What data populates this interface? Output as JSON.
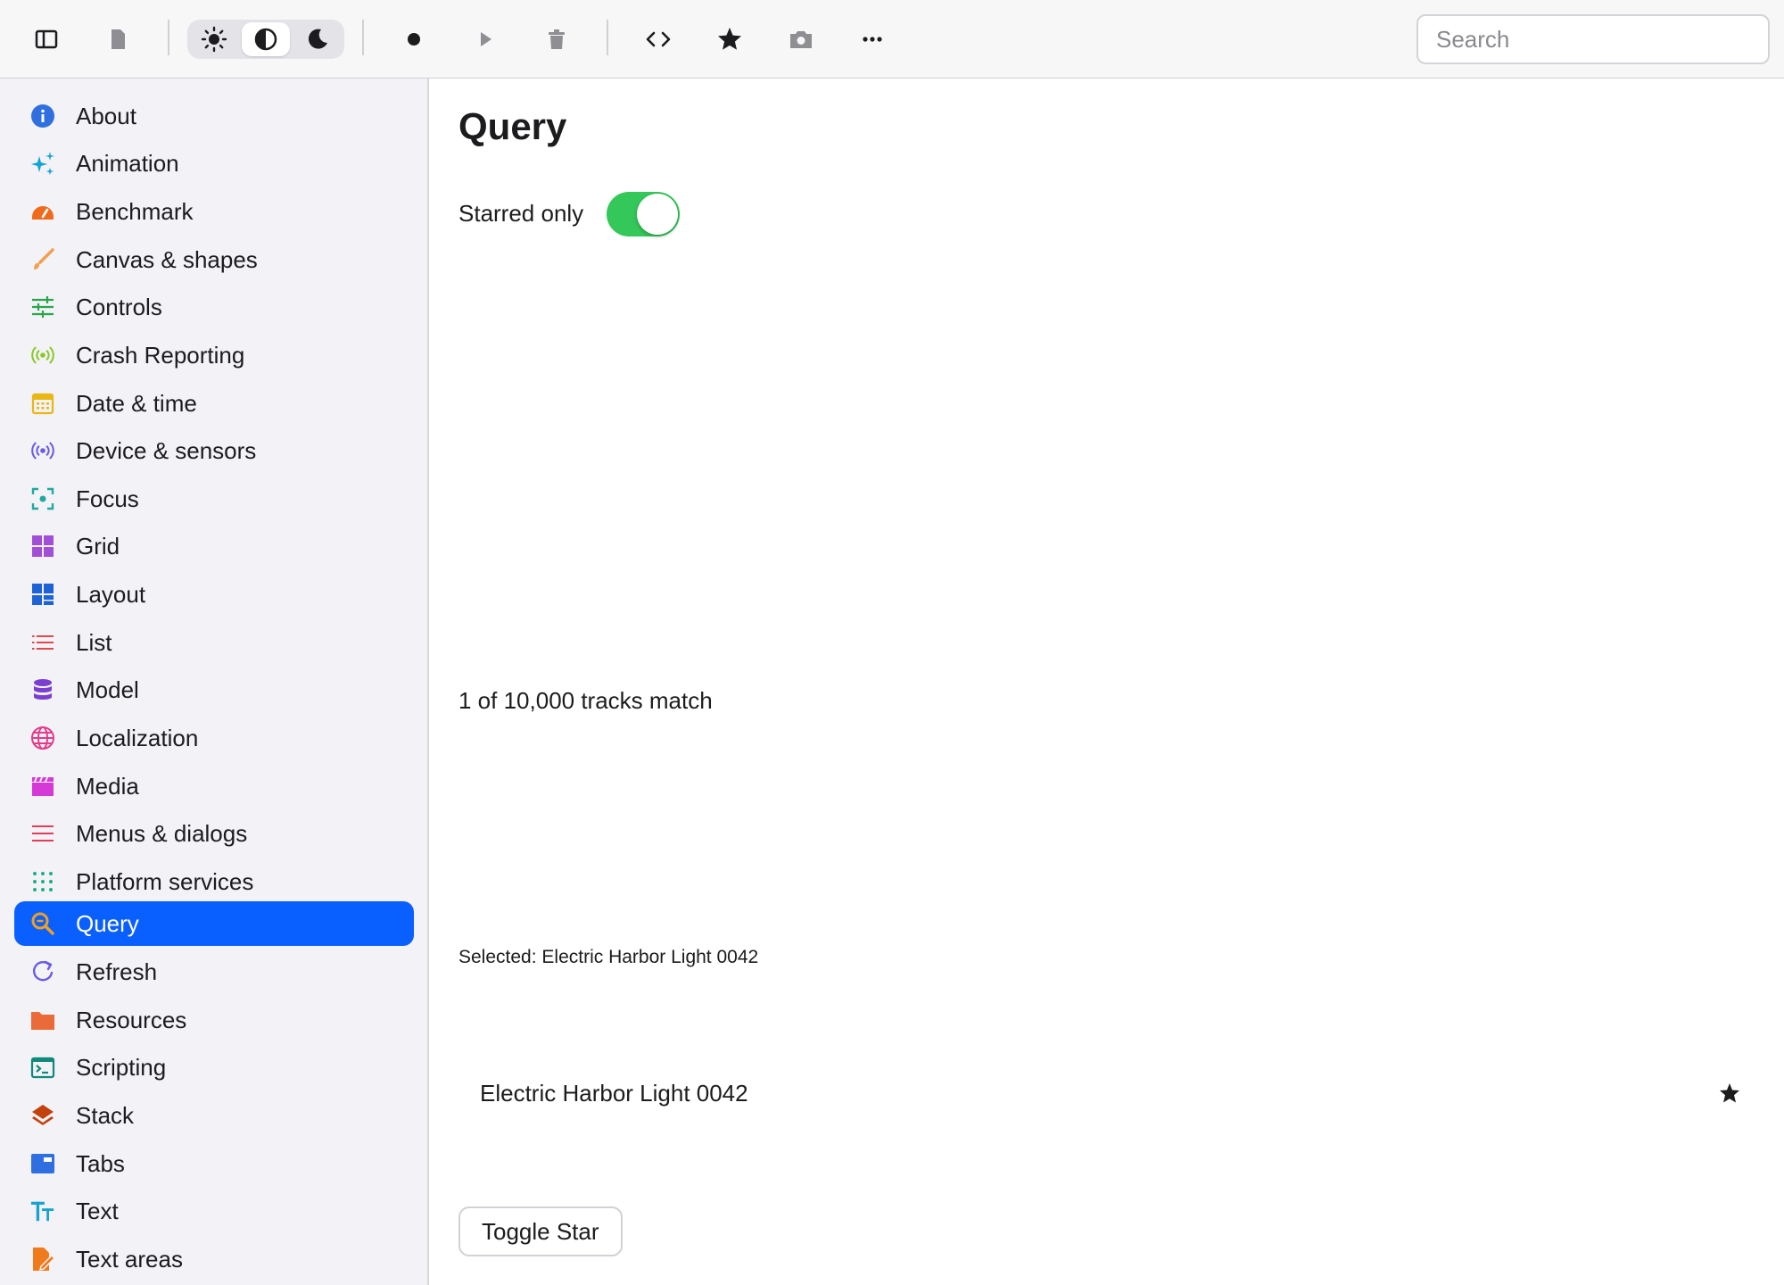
{
  "toolbar": {
    "icons": [
      "sidebar-toggle-icon",
      "document-icon",
      "sun-icon",
      "contrast-icon",
      "moon-icon",
      "record-icon",
      "play-icon",
      "trash-icon",
      "code-icon",
      "star-icon",
      "camera-icon",
      "more-icon"
    ],
    "theme_selected": "auto",
    "search_placeholder": "Search"
  },
  "sidebar": {
    "items": [
      {
        "label": "About",
        "icon": "info-icon",
        "color": "#2f6fe0"
      },
      {
        "label": "Animation",
        "icon": "sparkles-icon",
        "color": "#12a4d8"
      },
      {
        "label": "Benchmark",
        "icon": "gauge-icon",
        "color": "#f06a1c"
      },
      {
        "label": "Canvas & shapes",
        "icon": "brush-icon",
        "color": "#f0a050"
      },
      {
        "label": "Controls",
        "icon": "sliders-icon",
        "color": "#2aa54a"
      },
      {
        "label": "Crash Reporting",
        "icon": "broadcast-icon",
        "color": "#8ac926"
      },
      {
        "label": "Date & time",
        "icon": "calendar-icon",
        "color": "#e8b714"
      },
      {
        "label": "Device & sensors",
        "icon": "sensor-icon",
        "color": "#6a5be2"
      },
      {
        "label": "Focus",
        "icon": "focus-icon",
        "color": "#1fa9a0"
      },
      {
        "label": "Grid",
        "icon": "grid-icon",
        "color": "#a24fd8"
      },
      {
        "label": "Layout",
        "icon": "layout-icon",
        "color": "#1e63d6"
      },
      {
        "label": "List",
        "icon": "list-icon",
        "color": "#e0494d"
      },
      {
        "label": "Model",
        "icon": "database-icon",
        "color": "#7a3fd0"
      },
      {
        "label": "Localization",
        "icon": "globe-icon",
        "color": "#e23d8a"
      },
      {
        "label": "Media",
        "icon": "clapperboard-icon",
        "color": "#d63ad6"
      },
      {
        "label": "Menus & dialogs",
        "icon": "menu-icon",
        "color": "#e23d5a"
      },
      {
        "label": "Platform services",
        "icon": "dots-grid-icon",
        "color": "#1fae8a"
      },
      {
        "label": "Query",
        "icon": "magnifier-icon",
        "color": "#f0a020",
        "selected": true
      },
      {
        "label": "Refresh",
        "icon": "refresh-icon",
        "color": "#6a5be2"
      },
      {
        "label": "Resources",
        "icon": "folder-icon",
        "color": "#ea6a3a"
      },
      {
        "label": "Scripting",
        "icon": "terminal-icon",
        "color": "#11897a"
      },
      {
        "label": "Stack",
        "icon": "layers-icon",
        "color": "#c2410c"
      },
      {
        "label": "Tabs",
        "icon": "tabs-icon",
        "color": "#2f6fe0"
      },
      {
        "label": "Text",
        "icon": "text-icon",
        "color": "#18a3cf"
      },
      {
        "label": "Text areas",
        "icon": "document-edit-icon",
        "color": "#f07a1c"
      }
    ]
  },
  "main": {
    "title": "Query",
    "toggle_label": "Starred only",
    "toggle_on": true,
    "match_count": "1 of 10,000 tracks match",
    "selected_text": "Selected: Electric Harbor Light 0042",
    "rows": [
      {
        "title": "Electric Harbor Light 0042",
        "starred": true
      }
    ],
    "toggle_star_label": "Toggle Star"
  },
  "colors": {
    "accent": "#0a60ff",
    "toggle_on": "#34c759",
    "sidebar_bg": "#f2f2f7"
  }
}
